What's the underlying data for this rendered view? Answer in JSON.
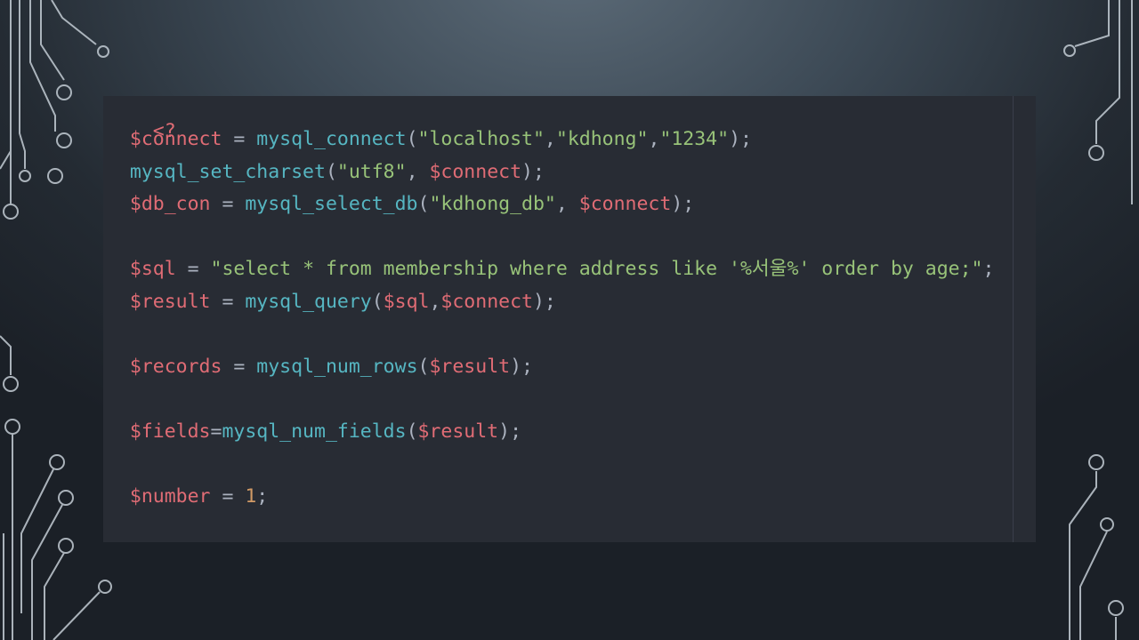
{
  "slide": {
    "code": {
      "open_tag": "<?",
      "line_connect": {
        "var": "$connect",
        "op": " = ",
        "fn": "mysql_connect",
        "p1": "(",
        "s1": "\"localhost\"",
        "c1": ",",
        "s2": "\"kdhong\"",
        "c2": ",",
        "s3": "\"1234\"",
        "end": ");"
      },
      "line_charset": {
        "fn": "mysql_set_charset",
        "p1": "(",
        "s1": "\"utf8\"",
        "c1": ", ",
        "var": "$connect",
        "end": ");"
      },
      "line_db": {
        "var": "$db_con",
        "op": " = ",
        "fn": "mysql_select_db",
        "p1": "(",
        "s1": "\"kdhong_db\"",
        "c1": ", ",
        "var2": "$connect",
        "end": ");"
      },
      "line_sql": {
        "var": "$sql",
        "op": " = ",
        "s1": "\"select * from membership where address like '%서울%' order by age;\"",
        "end": ";"
      },
      "line_result": {
        "var": "$result",
        "op": " = ",
        "fn": "mysql_query",
        "p1": "(",
        "arg1": "$sql",
        "c1": ",",
        "arg2": "$connect",
        "end": ");"
      },
      "line_records": {
        "var": "$records",
        "op": " = ",
        "fn": "mysql_num_rows",
        "p1": "(",
        "arg1": "$result",
        "end": ");"
      },
      "line_fields": {
        "var": "$fields",
        "op": "=",
        "fn": "mysql_num_fields",
        "p1": "(",
        "arg1": "$result",
        "end": ");"
      },
      "line_number": {
        "var": "$number",
        "op": " = ",
        "num": "1",
        "end": ";"
      },
      "close_tag": "?>"
    },
    "colors": {
      "background": "#2f3a44",
      "code_bg": "#282c34",
      "variable": "#e06c75",
      "function": "#56b6c2",
      "string": "#98c379",
      "number": "#d19a66",
      "punctuation": "#abb2bf",
      "circuit": "#c9d2da"
    }
  }
}
